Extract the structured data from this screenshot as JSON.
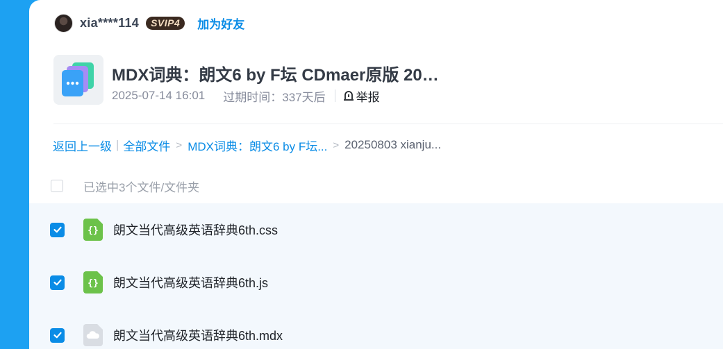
{
  "user": {
    "name": "xia****114",
    "vip": "SVIP4",
    "add_friend": "加为好友"
  },
  "share": {
    "title": "MDX词典：朗文6 by F坛 CDmaer原版 20…",
    "date": "2025-07-14 16:01",
    "expire": "过期时间：337天后",
    "report": "举报"
  },
  "breadcrumb": {
    "back": "返回上一级",
    "all_files": "全部文件",
    "folder": "MDX词典：朗文6 by F坛...",
    "current": "20250803 xianju..."
  },
  "selection": {
    "text": "已选中3个文件/文件夹"
  },
  "files": [
    {
      "name": "朗文当代高级英语辞典6th.css",
      "icon": "code-file-icon",
      "checked": true
    },
    {
      "name": "朗文当代高级英语辞典6th.js",
      "icon": "code-file-icon",
      "checked": true
    },
    {
      "name": "朗文当代高级英语辞典6th.mdx",
      "icon": "cloud-file-icon",
      "checked": true
    }
  ],
  "colors": {
    "accent": "#0a8ce6",
    "sidebar": "#1da1f2",
    "list_bg": "#f3f8fd",
    "code_icon": "#6cc24a"
  }
}
